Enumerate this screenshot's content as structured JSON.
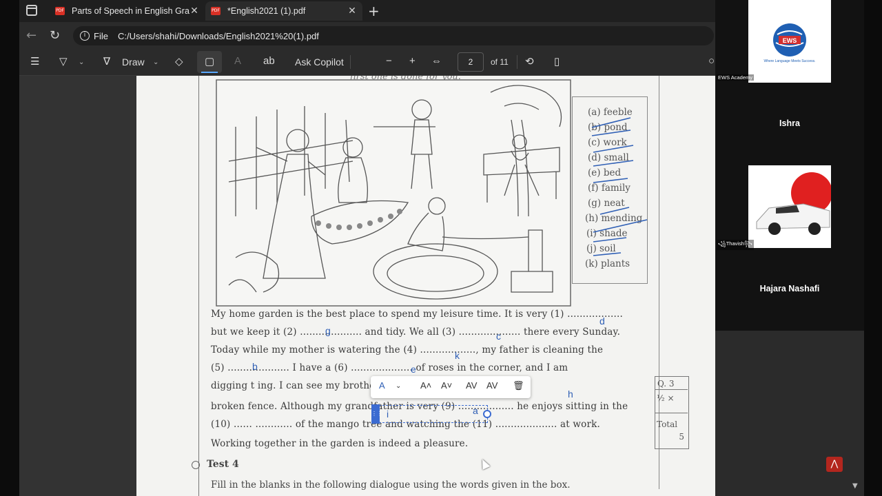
{
  "browser": {
    "tabs": [
      {
        "title": "Parts of Speech in English Gramm",
        "active": false
      },
      {
        "title": "*English2021 (1).pdf",
        "active": true
      }
    ],
    "address": {
      "scheme_label": "File",
      "url": "C:/Users/shahi/Downloads/English2021%20(1).pdf"
    }
  },
  "pdf_toolbar": {
    "draw_label": "Draw",
    "copilot_label": "Ask Copilot",
    "page_current": "2",
    "page_total_label": "of 11"
  },
  "document": {
    "top_cut_text": "first one is done for you.",
    "words": [
      "(a) feeble",
      "(b) pond",
      "(c) work",
      "(d) small",
      "(e) bed",
      "(f) family",
      "(g) neat",
      "(h) mending",
      "(i) shade",
      "(j) soil",
      "(k) plants"
    ],
    "paragraph_lines": [
      "My home garden is the best place to spend my leisure time. It is very (1) ..................",
      "but we keep it (2) .................... and tidy. We all (3) .................... there every Sunday.",
      "Today while my mother is watering the (4) .................., my father is cleaning the",
      "(5) .................... I have a (6) .................... of roses in the corner, and I am",
      "digging t                                              ing. I can see my brother (8) .................. the",
      "broken fence. Although my grandfather is very (9) .................. he enjoys sitting in the",
      "(10) ......                      ............ of the mango tree and watching the (11) .................... at work.",
      "Working together in the garden is indeed a pleasure."
    ],
    "handwritten_answers": [
      "d",
      "g",
      "c",
      "k",
      "b",
      "e",
      "h",
      "a"
    ],
    "textbox_value": "i",
    "q_label": "Q. 3",
    "q_half": "½ ×",
    "q_total_label": "Total",
    "q_total_value": "5",
    "test_heading": "Test 4",
    "fill_line": "Fill in the blanks in the following dialogue using the words given in the box."
  },
  "participants": {
    "tile1_tag": "EWS Academy",
    "tile1_logo_text": "EWS",
    "tile1_slogan": "Where Language Meets Success.",
    "name1": "Ishra",
    "tile2_tag": "꧁Thavish꧂",
    "name2": "Hajara Nashafi"
  },
  "colors": {
    "accent": "#5aa9ff",
    "ink": "#2f5fb5",
    "pdf_red": "#d93025"
  }
}
